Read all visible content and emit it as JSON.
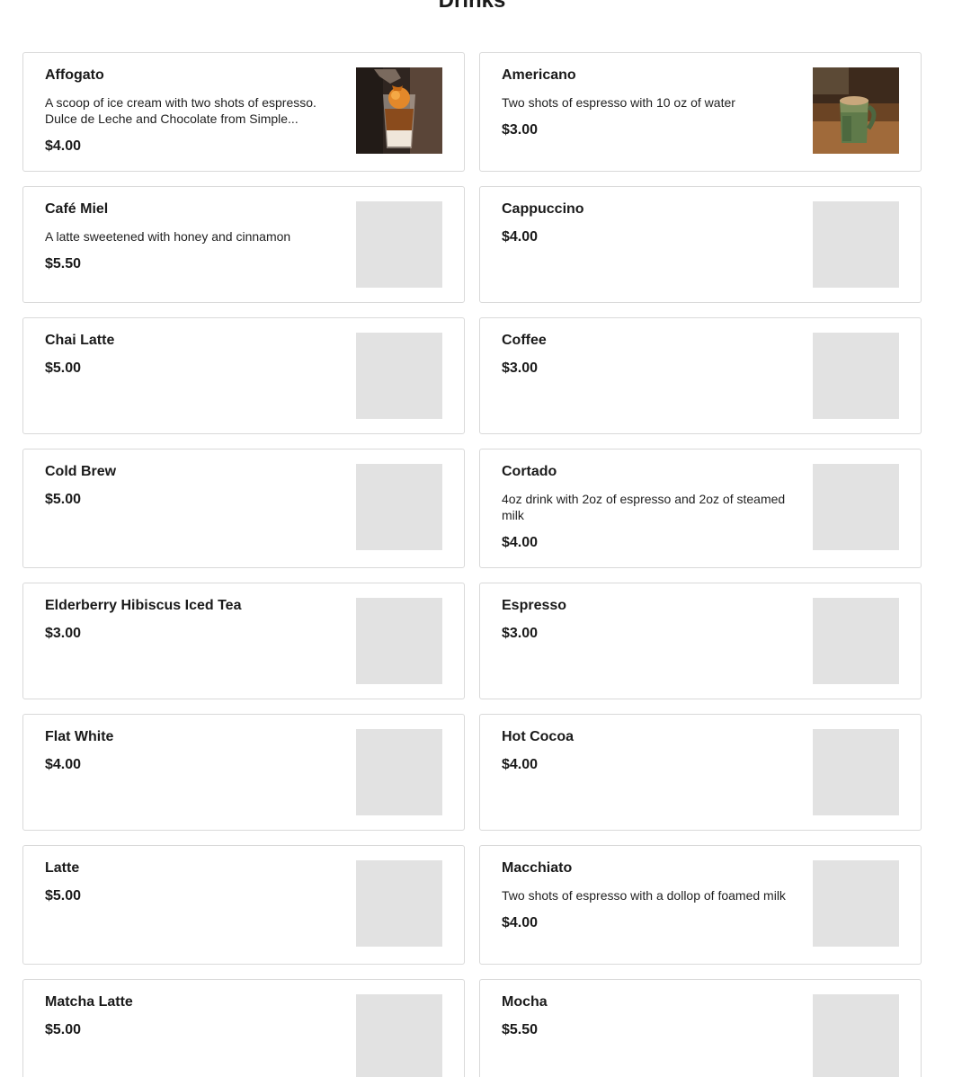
{
  "section": {
    "title": "Drinks"
  },
  "items": [
    {
      "name": "Affogato",
      "description": "A scoop of ice cream with two shots of espresso. Dulce de Leche and Chocolate from Simple...",
      "price": "$4.00",
      "image": "affogato-photo"
    },
    {
      "name": "Americano",
      "description": "Two shots of espresso with 10 oz of water",
      "price": "$3.00",
      "image": "americano-photo"
    },
    {
      "name": "Café Miel",
      "description": "A latte sweetened with honey and cinnamon",
      "price": "$5.50",
      "image": "placeholder"
    },
    {
      "name": "Cappuccino",
      "description": "",
      "price": "$4.00",
      "image": "placeholder"
    },
    {
      "name": "Chai Latte",
      "description": "",
      "price": "$5.00",
      "image": "placeholder"
    },
    {
      "name": "Coffee",
      "description": "",
      "price": "$3.00",
      "image": "placeholder"
    },
    {
      "name": "Cold Brew",
      "description": "",
      "price": "$5.00",
      "image": "placeholder"
    },
    {
      "name": "Cortado",
      "description": "4oz drink with 2oz of espresso and 2oz of steamed milk",
      "price": "$4.00",
      "image": "placeholder"
    },
    {
      "name": "Elderberry Hibiscus Iced Tea",
      "description": "",
      "price": "$3.00",
      "image": "placeholder"
    },
    {
      "name": "Espresso",
      "description": "",
      "price": "$3.00",
      "image": "placeholder"
    },
    {
      "name": "Flat White",
      "description": "",
      "price": "$4.00",
      "image": "placeholder"
    },
    {
      "name": "Hot Cocoa",
      "description": "",
      "price": "$4.00",
      "image": "placeholder"
    },
    {
      "name": "Latte",
      "description": "",
      "price": "$5.00",
      "image": "placeholder"
    },
    {
      "name": "Macchiato",
      "description": "Two shots of espresso with a dollop of foamed milk",
      "price": "$4.00",
      "image": "placeholder"
    },
    {
      "name": "Matcha Latte",
      "description": "",
      "price": "$5.00",
      "image": "placeholder"
    },
    {
      "name": "Mocha",
      "description": "",
      "price": "$5.50",
      "image": "placeholder"
    }
  ],
  "colors": {
    "card_border": "#d9d9d9",
    "placeholder_bg": "#e2e2e2",
    "text": "#1a1a1a"
  }
}
